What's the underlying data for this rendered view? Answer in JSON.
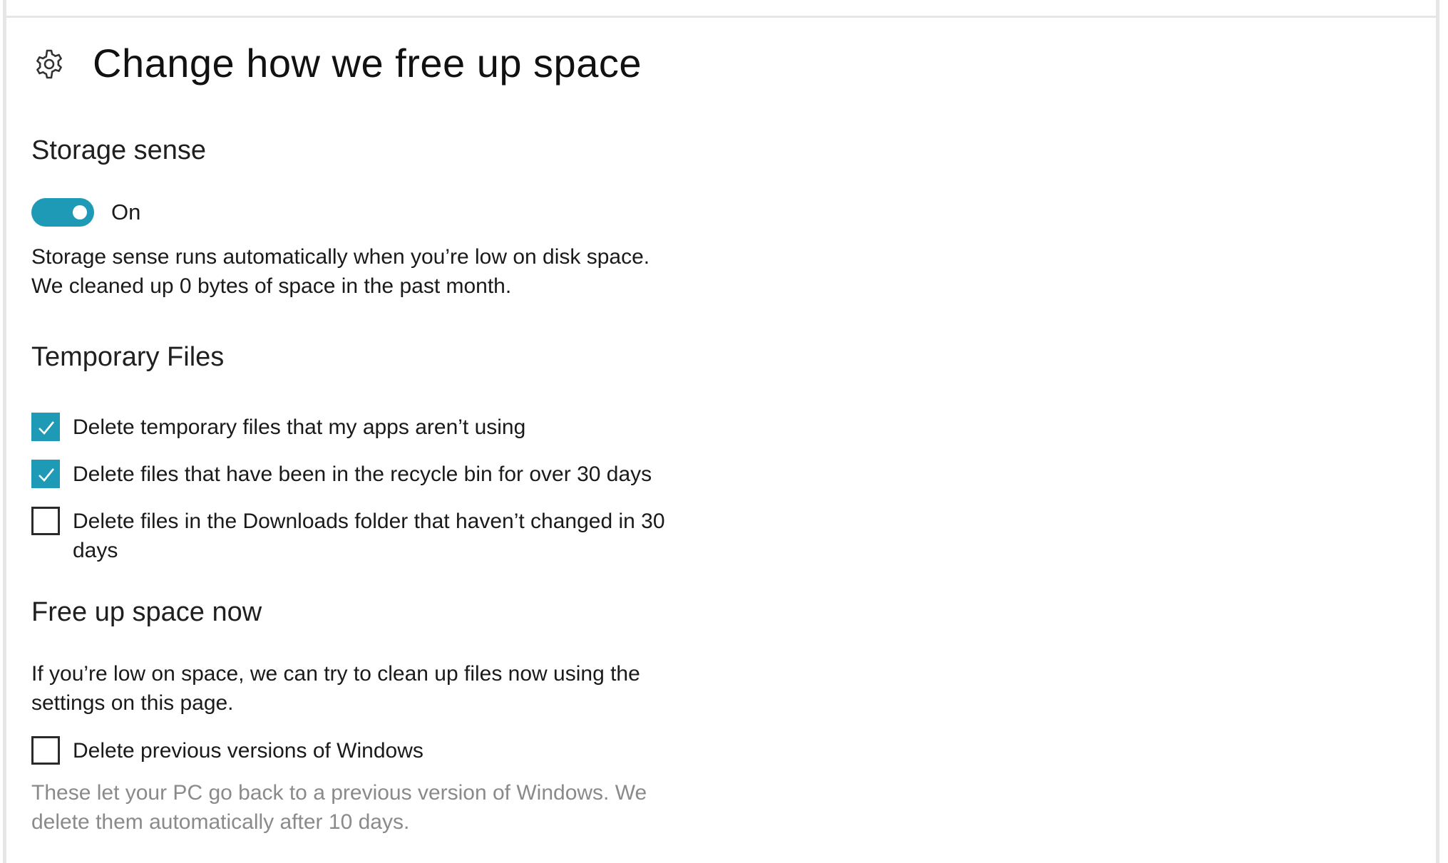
{
  "header": {
    "icon": "gear-icon",
    "title": "Change how we free up space"
  },
  "storage_sense": {
    "title": "Storage sense",
    "toggle_state": "On",
    "toggle_on": true,
    "description_line1": "Storage sense runs automatically when you’re low on disk space.",
    "description_line2": "We cleaned up 0 bytes of space in the past month."
  },
  "temporary_files": {
    "title": "Temporary Files",
    "options": [
      {
        "label": "Delete temporary files that my apps aren’t using",
        "checked": true
      },
      {
        "label": "Delete files that have been in the recycle bin for over 30 days",
        "checked": true
      },
      {
        "label": "Delete files in the Downloads folder that haven’t changed in 30 days",
        "checked": false
      }
    ]
  },
  "free_up_now": {
    "title": "Free up space now",
    "description": "If you’re low on space, we can try to clean up files now using the settings on this page.",
    "option": {
      "label": "Delete previous versions of Windows",
      "checked": false
    },
    "note": "These let your PC go back to a previous version of Windows. We delete them automatically after 10 days."
  },
  "colors": {
    "accent": "#1e9ab7",
    "muted_text": "#8a8a8a"
  }
}
